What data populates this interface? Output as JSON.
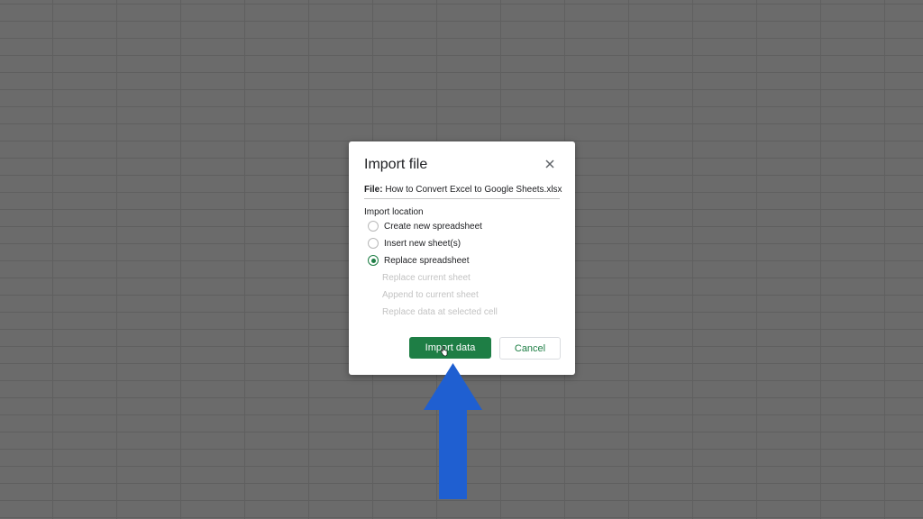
{
  "dialog": {
    "title": "Import file",
    "file_label": "File:",
    "file_name": "How to Convert Excel to Google Sheets.xlsx",
    "section_label": "Import location",
    "options": [
      {
        "label": "Create new spreadsheet",
        "checked": false
      },
      {
        "label": "Insert new sheet(s)",
        "checked": false
      },
      {
        "label": "Replace spreadsheet",
        "checked": true
      }
    ],
    "sub_options": [
      "Replace current sheet",
      "Append to current sheet",
      "Replace data at selected cell"
    ],
    "import_button_label": "Import data",
    "cancel_button_label": "Cancel"
  },
  "colors": {
    "accent_green": "#1e7e45",
    "annotation_arrow": "#1f5fd1",
    "backdrop": "#6b6b6b"
  },
  "icons": {
    "close": "close-icon",
    "pointer": "hand-pointer-icon",
    "annotation": "arrow-up-icon"
  }
}
